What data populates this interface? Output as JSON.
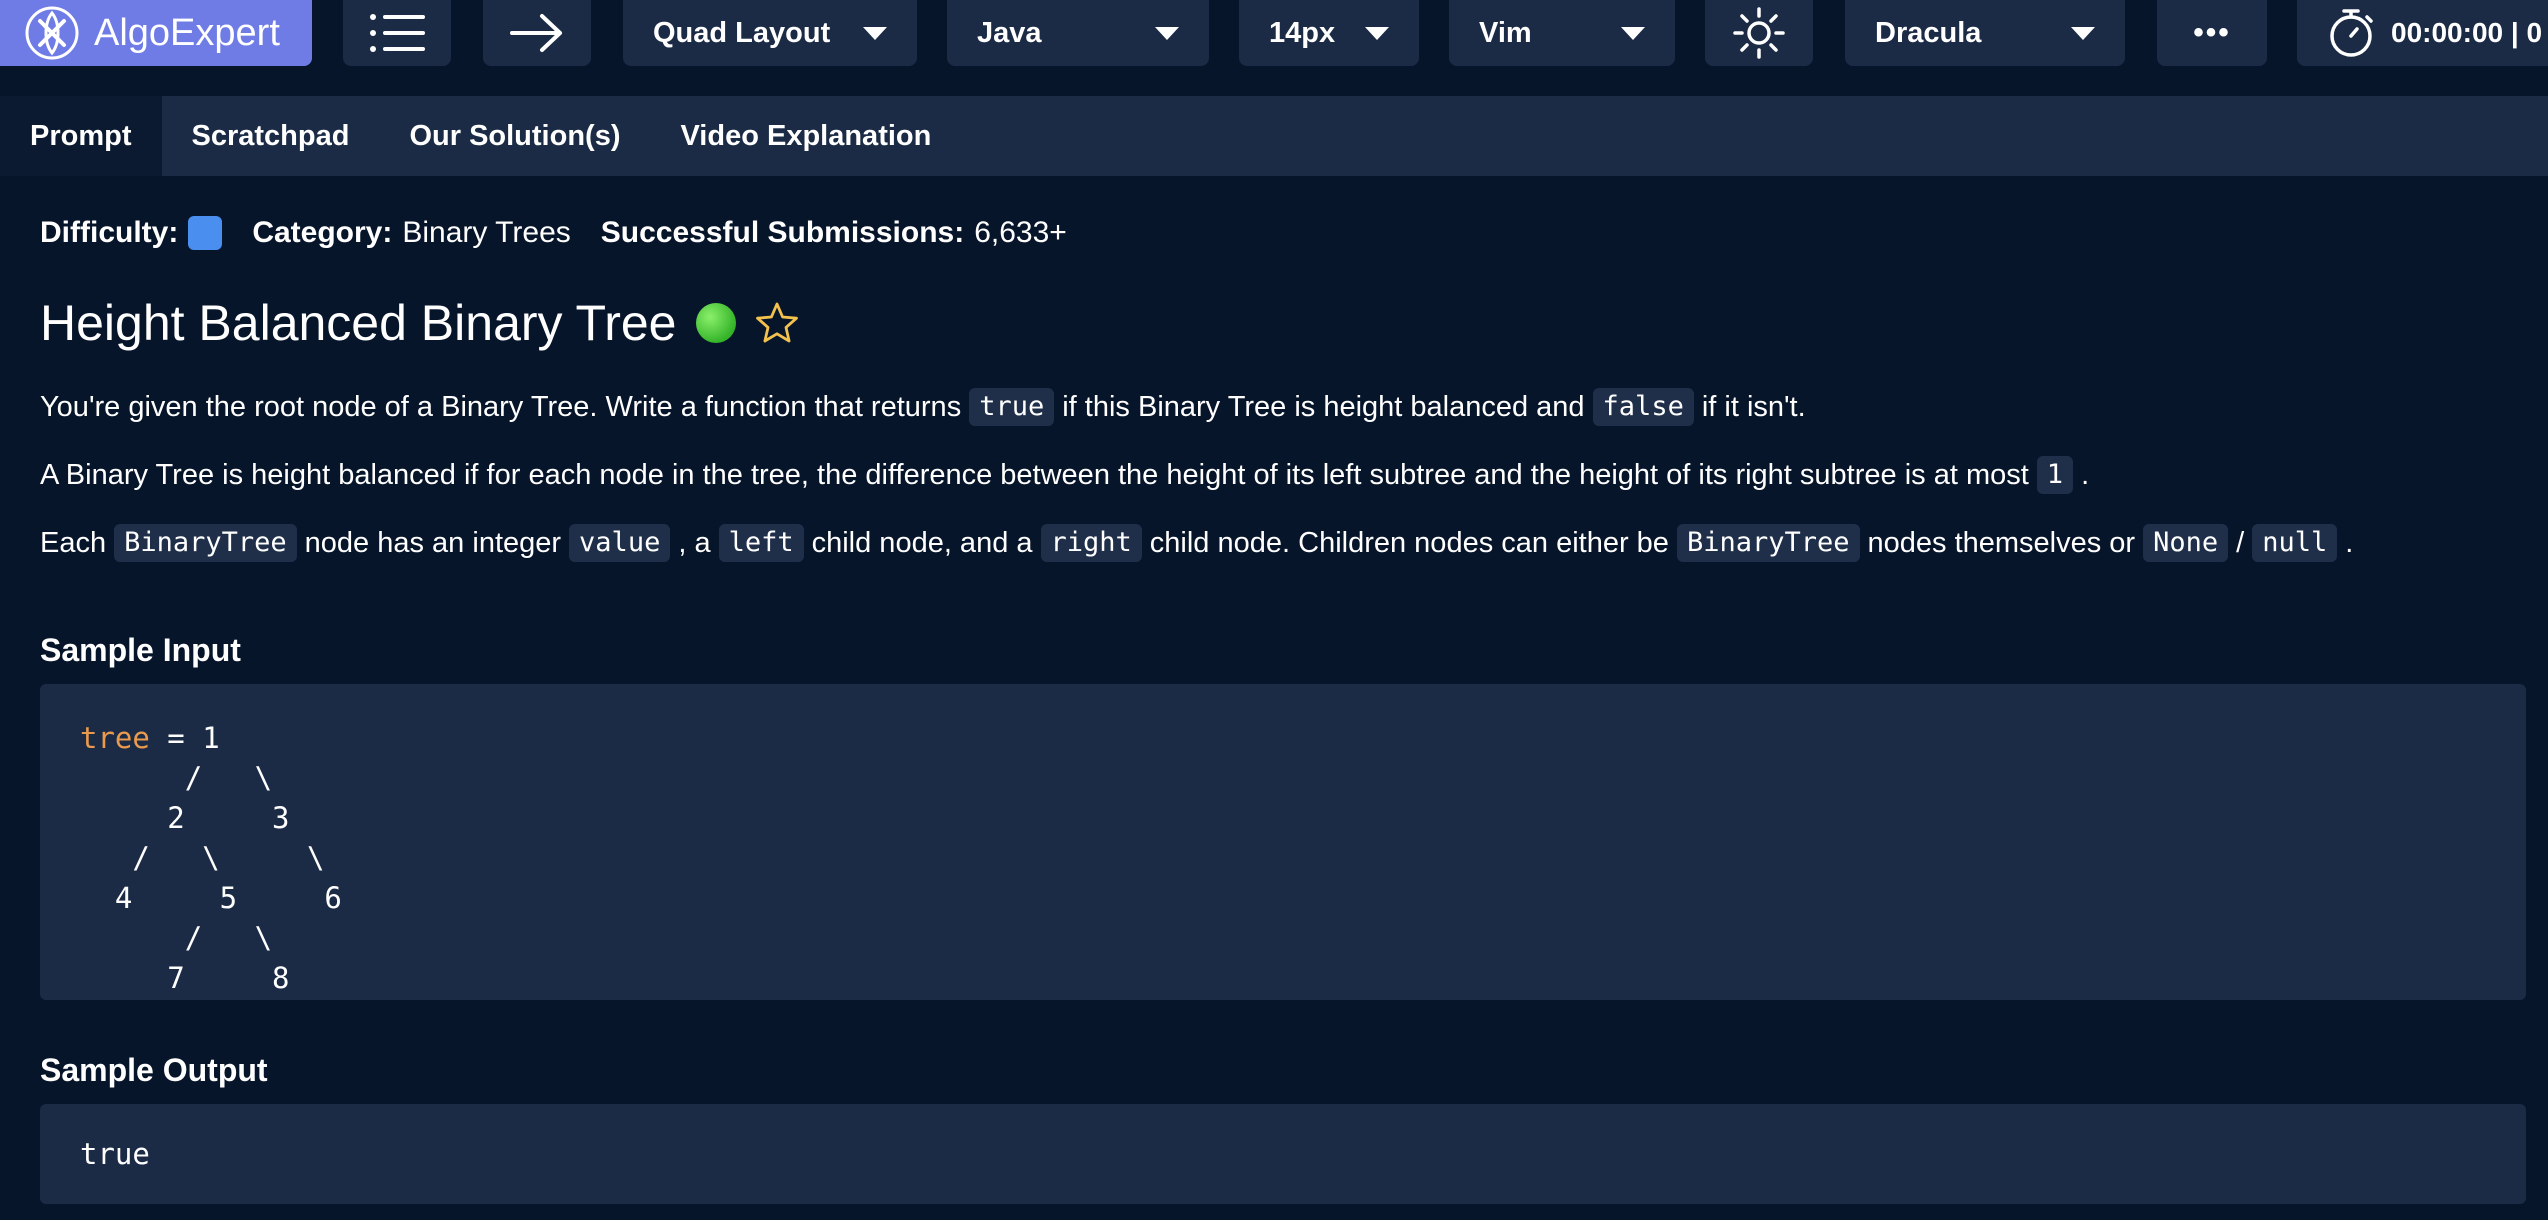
{
  "toolbar": {
    "logo_text": "AlgoExpert",
    "layout_label": "Quad Layout",
    "language_label": "Java",
    "font_size_label": "14px",
    "keymap_label": "Vim",
    "theme_label": "Dracula",
    "more_label": "•••",
    "timer_label": "00:00:00 | 0"
  },
  "tabs": [
    {
      "label": "Prompt",
      "active": true
    },
    {
      "label": "Scratchpad",
      "active": false
    },
    {
      "label": "Our Solution(s)",
      "active": false
    },
    {
      "label": "Video Explanation",
      "active": false
    }
  ],
  "meta": {
    "difficulty_label": "Difficulty:",
    "category_label": "Category:",
    "category_value": "Binary Trees",
    "submissions_label": "Successful Submissions:",
    "submissions_value": "6,633+"
  },
  "problem": {
    "title": "Height Balanced Binary Tree",
    "p1": {
      "t1": "You're given the root node of a Binary Tree. Write a function that returns",
      "c1": "true",
      "t2": "if this Binary Tree is height balanced and",
      "c2": "false",
      "t3": "if it isn't."
    },
    "p2": {
      "t1": "A Binary Tree is height balanced if for each node in the tree, the difference between the height of its left subtree and the height of its right subtree is at most",
      "c1": "1",
      "t2": "."
    },
    "p3": {
      "t1": "Each",
      "c1": "BinaryTree",
      "t2": "node has an integer",
      "c2": "value",
      "t3": ", a",
      "c3": "left",
      "t4": "child node, and a",
      "c4": "right",
      "t5": "child node. Children nodes can either be",
      "c5": "BinaryTree",
      "t6": "nodes themselves or",
      "c6": "None",
      "t7": "/",
      "c7": "null",
      "t8": "."
    }
  },
  "sample_input": {
    "heading": "Sample Input",
    "var_name": "tree",
    "first_line_rest": " = 1",
    "tree_lines": "      /   \\\n     2     3\n   /   \\     \\\n  4     5     6\n      /   \\\n     7     8"
  },
  "sample_output": {
    "heading": "Sample Output",
    "value": "true"
  },
  "colors": {
    "background": "#07152a",
    "panel": "#1b2b45",
    "logo_bg": "#6f7ce6",
    "difficulty": "#4a8ef0",
    "keyword": "#e99a4d",
    "status_dot": "#35b42a",
    "star": "#f2c14e"
  }
}
